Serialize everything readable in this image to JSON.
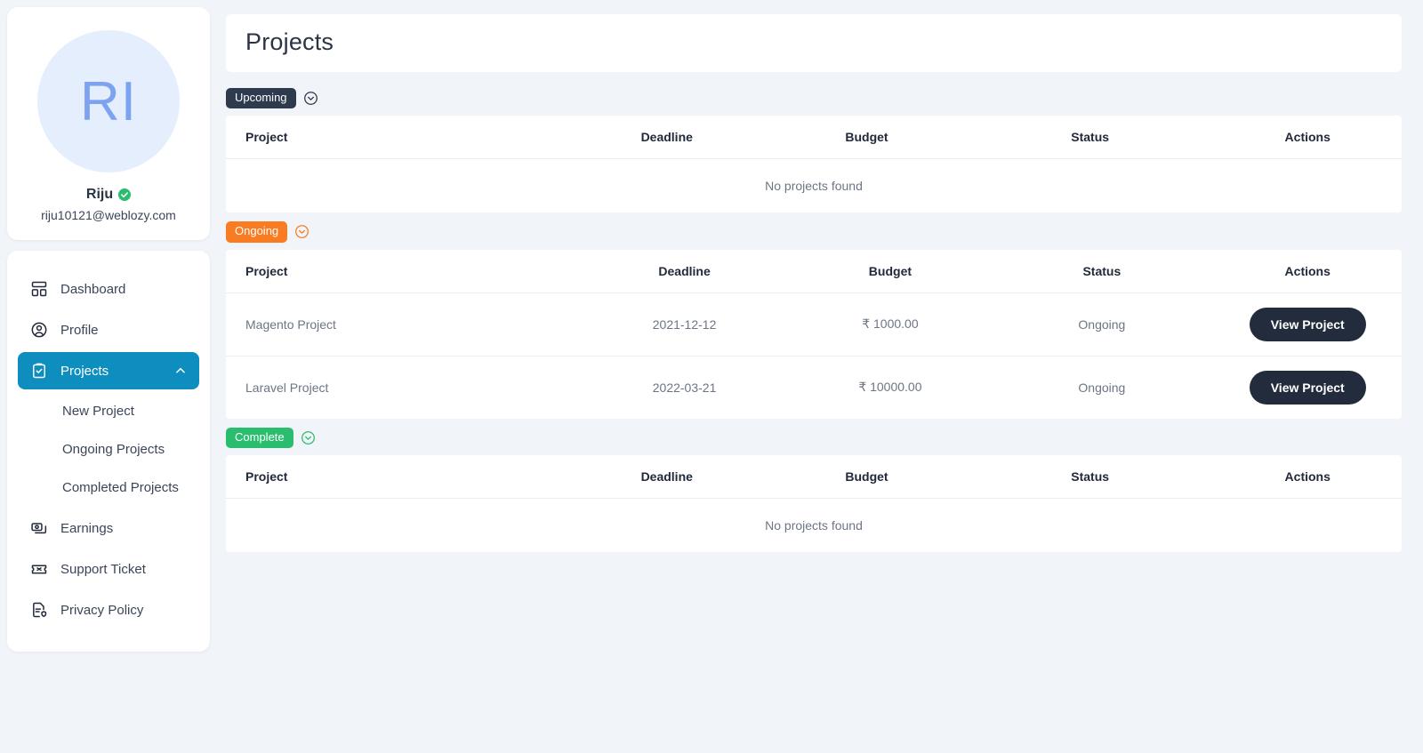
{
  "profile": {
    "initials": "RI",
    "name": "Riju",
    "email": "riju10121@weblozy.com",
    "verified_icon": "verified-check-icon"
  },
  "sidebar": {
    "items": [
      {
        "label": "Dashboard",
        "icon": "dashboard-icon"
      },
      {
        "label": "Profile",
        "icon": "user-circle-icon"
      },
      {
        "label": "Projects",
        "icon": "clipboard-check-icon",
        "chevron": "chevron-up-icon",
        "active": true
      }
    ],
    "sub_items": [
      {
        "label": "New Project"
      },
      {
        "label": "Ongoing Projects"
      },
      {
        "label": "Completed Projects"
      }
    ],
    "items_after": [
      {
        "label": "Earnings",
        "icon": "money-stack-icon"
      },
      {
        "label": "Support Ticket",
        "icon": "ticket-icon"
      },
      {
        "label": "Privacy Policy",
        "icon": "document-shield-icon"
      }
    ]
  },
  "header": {
    "title": "Projects"
  },
  "columns": [
    "Project",
    "Deadline",
    "Budget",
    "Status",
    "Actions"
  ],
  "empty_text": "No projects found",
  "sections": [
    {
      "badge": "Upcoming",
      "badge_color": "#2e3a4e",
      "toggle_icon": "circle-chevron-down-icon",
      "rows": []
    },
    {
      "badge": "Ongoing",
      "badge_color": "#f97c22",
      "toggle_icon": "circle-chevron-down-icon",
      "rows": [
        {
          "project": "Magento Project",
          "deadline": "2021-12-12",
          "budget": "₹ 1000.00",
          "status": "Ongoing",
          "action": "View Project"
        },
        {
          "project": "Laravel Project",
          "deadline": "2022-03-21",
          "budget": "₹ 10000.00",
          "status": "Ongoing",
          "action": "View Project"
        }
      ]
    },
    {
      "badge": "Complete",
      "badge_color": "#2bbd6e",
      "toggle_icon": "circle-chevron-down-icon",
      "rows": []
    }
  ],
  "colors": {
    "accent": "#0e8ebf",
    "dark": "#232c3d",
    "orange": "#f97c22",
    "green": "#2bbd6e",
    "page_bg": "#f1f4f8"
  }
}
